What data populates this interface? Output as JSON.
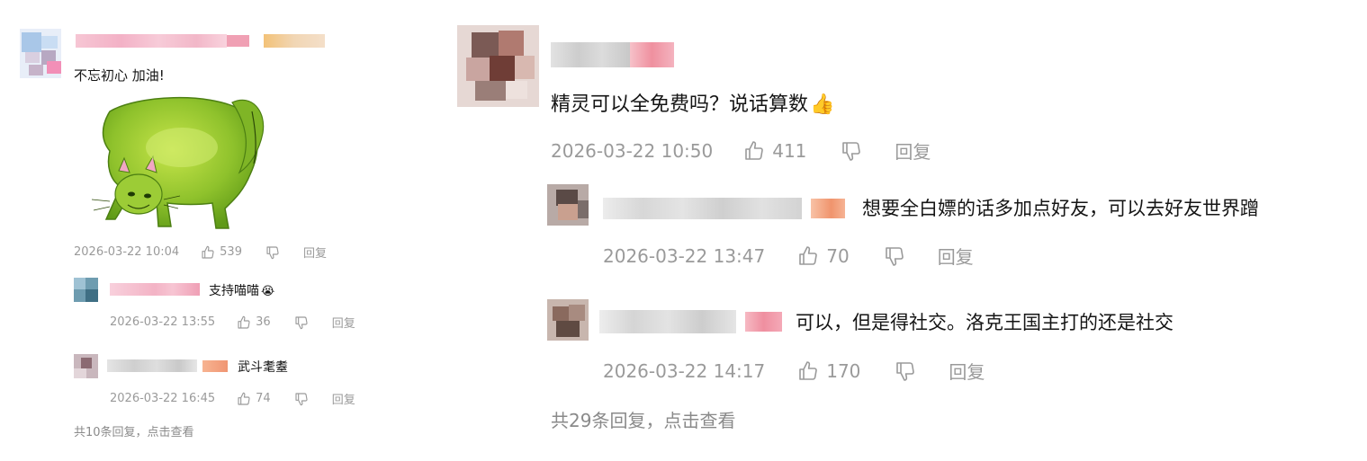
{
  "left_comment": {
    "author_badge_color": "#f1c27d",
    "text": "不忘初心 加油!",
    "sticker_icon": "green-cat-sticker",
    "timestamp": "2026-03-22 10:04",
    "likes": "539",
    "reply_label": "回复",
    "replies": [
      {
        "text": "支持喵喵",
        "emoji": "😭",
        "timestamp": "2026-03-22 13:55",
        "likes": "36",
        "reply_label": "回复"
      },
      {
        "text": "武斗耄耋",
        "timestamp": "2026-03-22 16:45",
        "likes": "74",
        "reply_label": "回复"
      }
    ],
    "more_replies": "共10条回复，点击查看"
  },
  "right_comment": {
    "text": "精灵可以全免费吗？说话算数",
    "emoji": "👍",
    "timestamp": "2026-03-22 10:50",
    "likes": "411",
    "reply_label": "回复",
    "replies": [
      {
        "text": "想要全白嫖的话多加点好友，可以去好友世界蹭",
        "timestamp": "2026-03-22 13:47",
        "likes": "70",
        "reply_label": "回复"
      },
      {
        "text": "可以，但是得社交。洛克王国主打的还是社交",
        "timestamp": "2026-03-22 14:17",
        "likes": "170",
        "reply_label": "回复"
      }
    ],
    "more_replies": "共29条回复，点击查看"
  },
  "colors": {
    "accent_pink": "#f4a5b6",
    "meta_gray": "#9a9a9a",
    "badge_orange": "#f3a27f"
  }
}
